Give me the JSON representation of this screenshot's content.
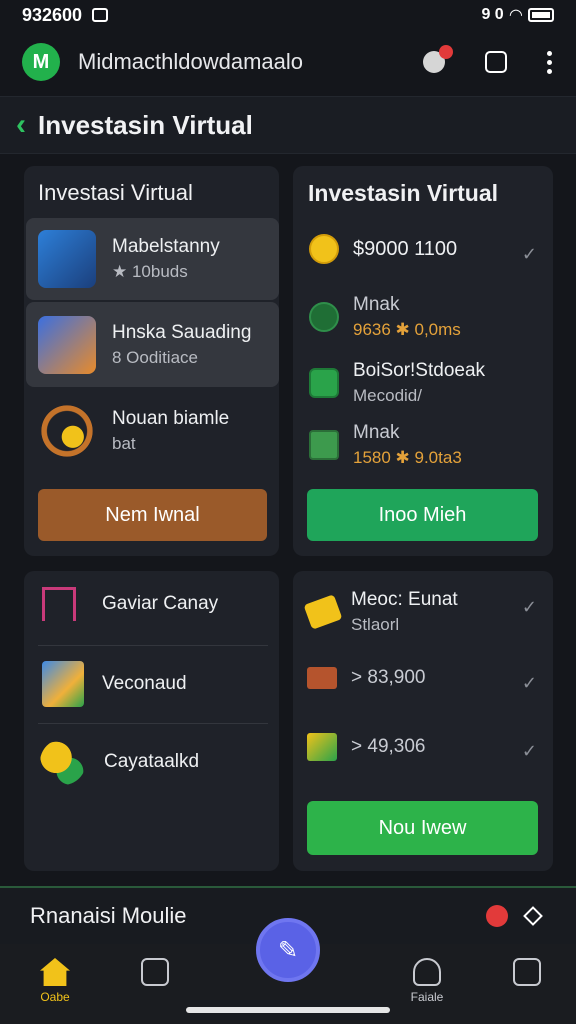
{
  "status_bar": {
    "time": "932600",
    "right_text": "9 0"
  },
  "app_bar": {
    "logo": "M",
    "title": "Midmacthldowdamaalo"
  },
  "page": {
    "title": "Investasin Virtual"
  },
  "card1": {
    "title": "Investasi Virtual",
    "items": [
      {
        "title": "Mabelstanny",
        "subtitle": "★ 10buds"
      },
      {
        "title": "Hnska Sauading",
        "subtitle": "8 Ooditiace"
      },
      {
        "title": "Nouan biamle",
        "subtitle": "bat"
      }
    ],
    "button": "Nem Iwnal"
  },
  "card2": {
    "title": "Investasin Virtual",
    "items": [
      {
        "title": "$9000 1100",
        "subtitle": ""
      },
      {
        "title": "Mnak",
        "subtitle": "9636 ✱ 0,0ms"
      },
      {
        "title": "BoiSor!Stdoeak",
        "subtitle": "Mecodid/"
      },
      {
        "title": "Mnak",
        "subtitle": "1580 ✱ 9.0ta3"
      }
    ],
    "button": "Inoo Mieh"
  },
  "card3": {
    "items": [
      {
        "title": "Gaviar Canay"
      },
      {
        "title": "Veconaud"
      },
      {
        "title": "Cayataalkd"
      }
    ]
  },
  "card4": {
    "items": [
      {
        "title": "Meoc: Eunat",
        "subtitle": "Stlaorl"
      },
      {
        "title": "> 83,900",
        "subtitle": ""
      },
      {
        "title": "> 49,306",
        "subtitle": ""
      }
    ],
    "button": "Nou Iwew"
  },
  "bottom_strip": {
    "title": "Rnanaisi Moulie"
  },
  "navbar": {
    "home_label": "Oabe",
    "right_label": "Faiale"
  },
  "colors": {
    "green": "#22b14c",
    "brown": "#9a5a2a",
    "accent": "#5a62e6"
  }
}
